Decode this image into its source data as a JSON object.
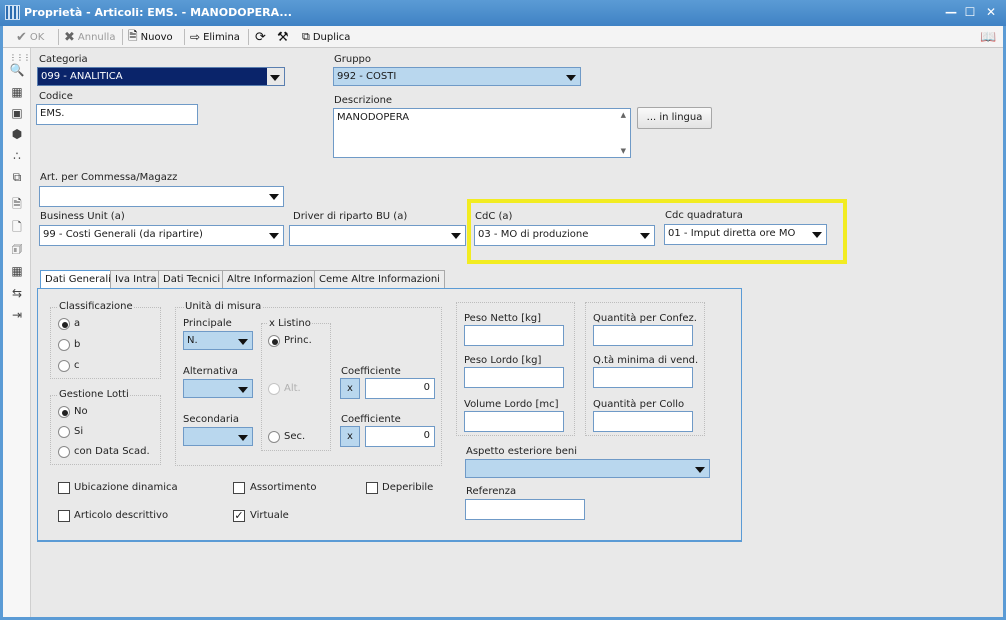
{
  "window": {
    "title": "Proprietà - Articoli: EMS. - MANODOPERA..."
  },
  "toolbar": {
    "ok": "OK",
    "annulla": "Annulla",
    "nuovo": "Nuovo",
    "elimina": "Elimina",
    "duplica": "Duplica"
  },
  "form": {
    "categoria_label": "Categoria",
    "categoria_value": "099 - ANALITICA",
    "gruppo_label": "Gruppo",
    "gruppo_value": "992 - COSTI",
    "codice_label": "Codice",
    "codice_value": "EMS.",
    "descrizione_label": "Descrizione",
    "descrizione_value": "MANODOPERA",
    "in_lingua": "... in lingua",
    "art_commessa_label": "Art. per Commessa/Magazz",
    "art_commessa_value": "",
    "business_unit_label": "Business Unit (a)",
    "business_unit_value": "99 - Costi Generali (da ripartire)",
    "driver_label": "Driver di riparto BU (a)",
    "driver_value": "",
    "cdc_label": "CdC (a)",
    "cdc_value": "03 - MO di produzione",
    "cdc_quadratura_label": "Cdc quadratura",
    "cdc_quadratura_value": "01 - Imput diretta ore MO"
  },
  "tabs": [
    "Dati Generali",
    "Iva Intra",
    "Dati Tecnici",
    "Altre Informazioni",
    "Ceme Altre Informazioni"
  ],
  "dati_generali": {
    "classificazione_label": "Classificazione",
    "classificazione_options": [
      "a",
      "b",
      "c"
    ],
    "gestione_lotti_label": "Gestione Lotti",
    "gestione_lotti_options": [
      "No",
      "Si",
      "con Data Scad."
    ],
    "unita_misura_label": "Unità di misura",
    "principale_label": "Principale",
    "principale_value": "N.",
    "alternativa_label": "Alternativa",
    "secondaria_label": "Secondaria",
    "listino_label": "x Listino",
    "listino_options": [
      "Princ.",
      "Alt.",
      "Sec."
    ],
    "coefficiente_label": "Coefficiente",
    "x": "x",
    "coefficiente_1": "0",
    "coefficiente_2": "0",
    "peso_netto_label": "Peso Netto [kg]",
    "peso_lordo_label": "Peso Lordo [kg]",
    "volume_lordo_label": "Volume Lordo [mc]",
    "qta_confez_label": "Quantità per Confez.",
    "qta_minima_label": "Q.tà minima di vend.",
    "qta_collo_label": "Quantità per Collo",
    "aspetto_label": "Aspetto esteriore beni",
    "referenza_label": "Referenza",
    "ubicazione_dinamica": "Ubicazione dinamica",
    "assortimento": "Assortimento",
    "deperibile": "Deperibile",
    "articolo_descrittivo": "Articolo descrittivo",
    "virtuale": "Virtuale",
    "check": "✓"
  },
  "colors": {
    "title_bar": "#4a8fd0",
    "highlight": "#f2ec22",
    "combo_fill": "#b9d7ee"
  }
}
